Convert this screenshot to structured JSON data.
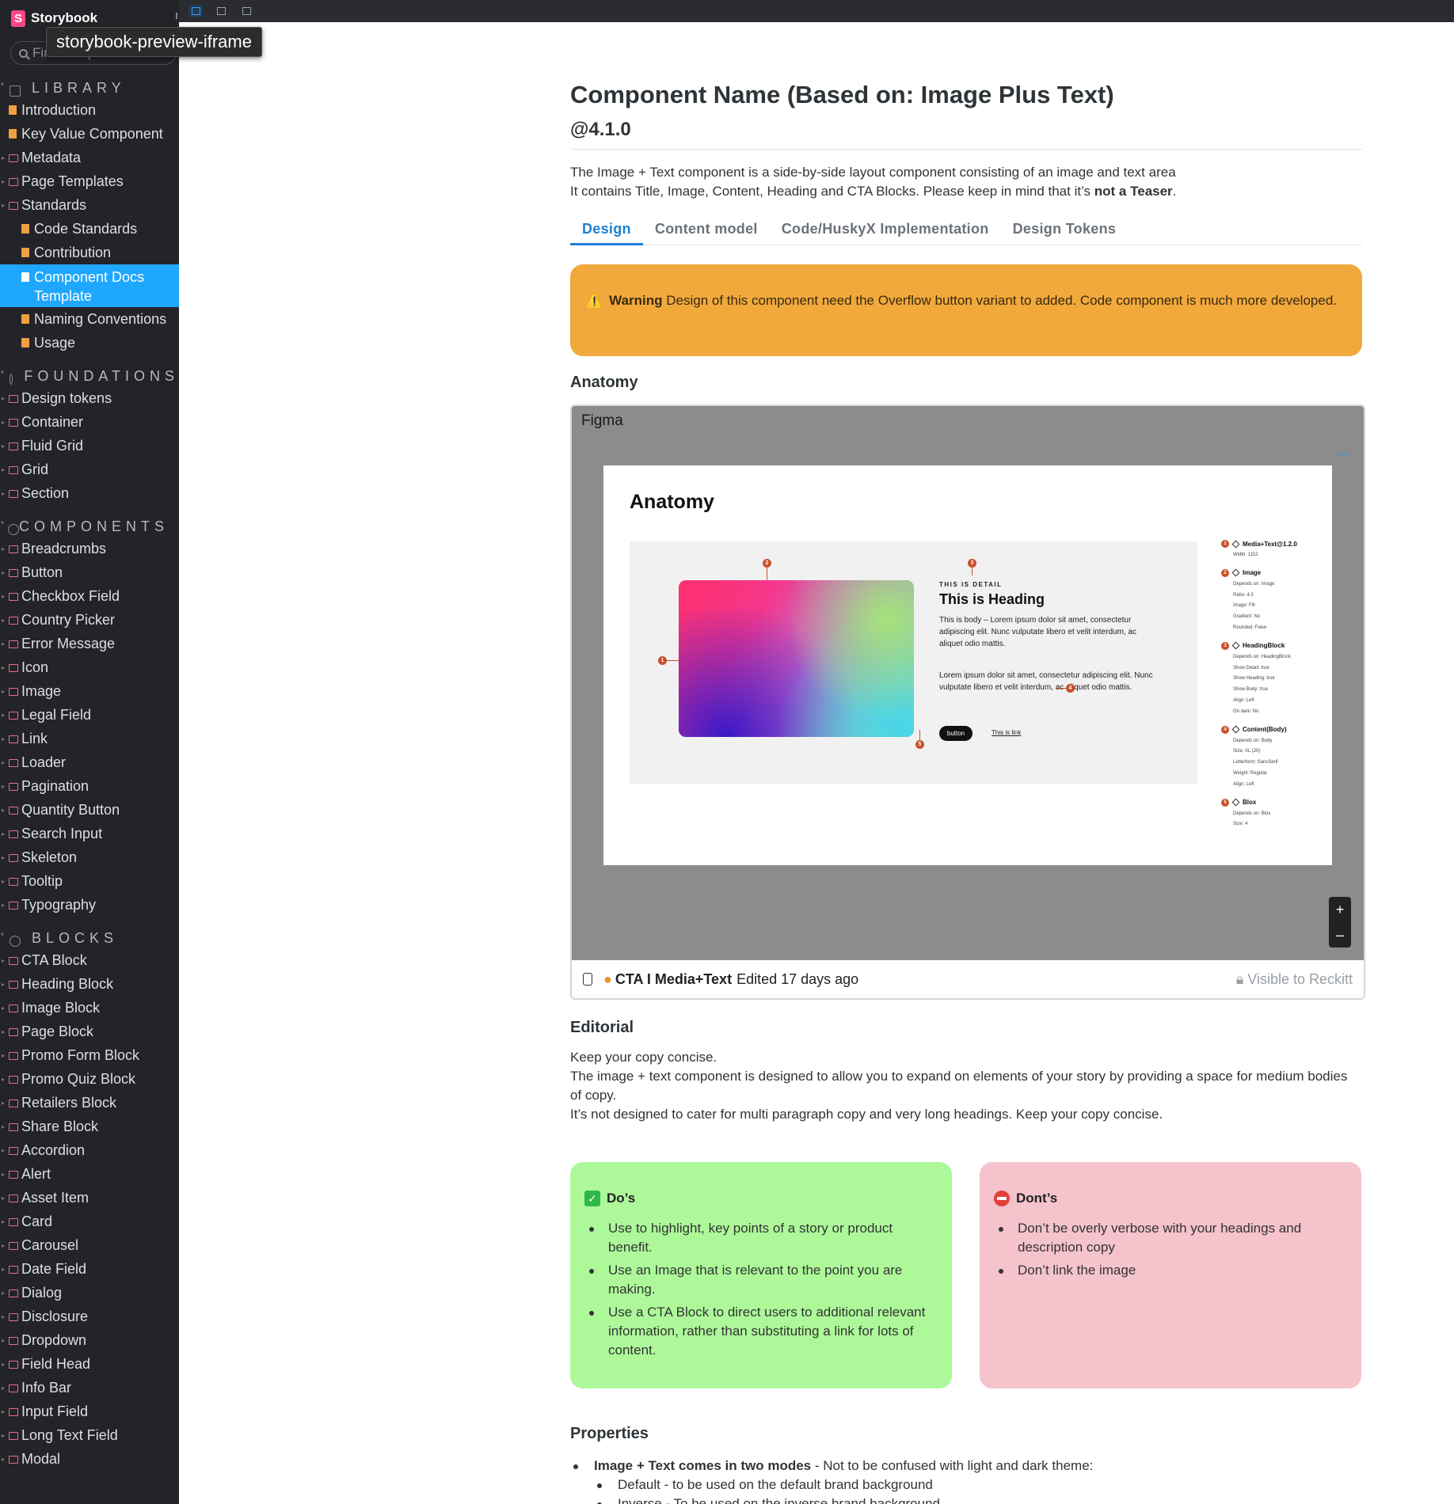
{
  "sidebar": {
    "brand": "Storybook",
    "search_placeholder": "Find components",
    "tooltip": "storybook-preview-iframe",
    "groups": [
      {
        "title": "LIBRARY",
        "items": [
          {
            "label": "Introduction",
            "type": "doc"
          },
          {
            "label": "Key Value Component",
            "type": "doc"
          },
          {
            "label": "Metadata",
            "type": "folder"
          },
          {
            "label": "Page Templates",
            "type": "folder"
          },
          {
            "label": "Standards",
            "type": "folder"
          },
          {
            "label": "Code Standards",
            "type": "doc",
            "sub": true
          },
          {
            "label": "Contribution",
            "type": "doc",
            "sub": true
          },
          {
            "label": "Component Docs Template",
            "type": "doc",
            "sub": true,
            "active": true
          },
          {
            "label": "Naming Conventions",
            "type": "doc",
            "sub": true
          },
          {
            "label": "Usage",
            "type": "doc",
            "sub": true
          }
        ]
      },
      {
        "title": "FOUNDATIONS",
        "items": [
          {
            "label": "Design tokens",
            "type": "folder"
          },
          {
            "label": "Container",
            "type": "folder"
          },
          {
            "label": "Fluid Grid",
            "type": "folder"
          },
          {
            "label": "Grid",
            "type": "folder"
          },
          {
            "label": "Section",
            "type": "folder"
          }
        ]
      },
      {
        "title": "COMPONENTS",
        "items": [
          {
            "label": "Breadcrumbs",
            "type": "folder"
          },
          {
            "label": "Button",
            "type": "folder"
          },
          {
            "label": "Checkbox Field",
            "type": "folder"
          },
          {
            "label": "Country Picker",
            "type": "folder"
          },
          {
            "label": "Error Message",
            "type": "folder"
          },
          {
            "label": "Icon",
            "type": "folder"
          },
          {
            "label": "Image",
            "type": "folder"
          },
          {
            "label": "Legal Field",
            "type": "folder"
          },
          {
            "label": "Link",
            "type": "folder"
          },
          {
            "label": "Loader",
            "type": "folder"
          },
          {
            "label": "Pagination",
            "type": "folder"
          },
          {
            "label": "Quantity Button",
            "type": "folder"
          },
          {
            "label": "Search Input",
            "type": "folder"
          },
          {
            "label": "Skeleton",
            "type": "folder"
          },
          {
            "label": "Tooltip",
            "type": "folder"
          },
          {
            "label": "Typography",
            "type": "folder"
          }
        ]
      },
      {
        "title": "BLOCKS",
        "items": [
          {
            "label": "CTA Block",
            "type": "folder"
          },
          {
            "label": "Heading Block",
            "type": "folder"
          },
          {
            "label": "Image Block",
            "type": "folder"
          },
          {
            "label": "Page Block",
            "type": "folder"
          },
          {
            "label": "Promo Form Block",
            "type": "folder"
          },
          {
            "label": "Promo Quiz Block",
            "type": "folder"
          },
          {
            "label": "Retailers Block",
            "type": "folder"
          },
          {
            "label": "Share Block",
            "type": "folder"
          },
          {
            "label": "Accordion",
            "type": "folder"
          },
          {
            "label": "Alert",
            "type": "folder"
          },
          {
            "label": "Asset Item",
            "type": "folder"
          },
          {
            "label": "Card",
            "type": "folder"
          },
          {
            "label": "Carousel",
            "type": "folder"
          },
          {
            "label": "Date Field",
            "type": "folder"
          },
          {
            "label": "Dialog",
            "type": "folder"
          },
          {
            "label": "Disclosure",
            "type": "folder"
          },
          {
            "label": "Dropdown",
            "type": "folder"
          },
          {
            "label": "Field Head",
            "type": "folder"
          },
          {
            "label": "Info Bar",
            "type": "folder"
          },
          {
            "label": "Input Field",
            "type": "folder"
          },
          {
            "label": "Long Text Field",
            "type": "folder"
          },
          {
            "label": "Modal",
            "type": "folder"
          }
        ]
      }
    ]
  },
  "doc": {
    "title": "Component Name (Based on: Image Plus Text)",
    "version": "@4.1.0",
    "intro_line1": "The Image + Text component is a side-by-side layout component consisting of an image and text area",
    "intro_line2_prefix": "It contains Title, Image, Content, Heading and CTA Blocks. Please keep in mind that it’s ",
    "intro_line2_bold": "not a Teaser",
    "intro_line2_suffix": ".",
    "tabs": [
      "Design",
      "Content model",
      "Code/HuskyX Implementation",
      "Design Tokens"
    ],
    "warning_icon": "⚠️",
    "warning_bold": "Warning",
    "warning_text": " Design of this component need the Overflow button variant to added. Code component is much more developed.",
    "anatomy_heading": "Anatomy",
    "figma": {
      "label": "Figma",
      "code_icon": "</>",
      "board_title": "Anatomy",
      "detail": "THIS IS  DETAIL",
      "heading": "This is Heading",
      "body1": "This is body – Lorem ipsum dolor sit amet, consectetur adipiscing elit. Nunc vulputate libero et velit interdum, ac aliquet odio mattis.",
      "body2": "Lorem ipsum dolor sit amet, consectetur adipiscing elit. Nunc vulputate libero et velit interdum, ac aliquet odio mattis.",
      "button": "button",
      "link": "This is link",
      "markers": [
        "1",
        "2",
        "3",
        "4",
        "5"
      ],
      "specs": [
        {
          "num": "1",
          "title": "Media+Text@1.2.0",
          "lines": [
            "Width: 1152"
          ]
        },
        {
          "num": "2",
          "title": "Image",
          "lines": [
            "Depends on: Image",
            "Ratio: 4:3",
            "Image: Fill",
            "Gradient: No",
            "Rounded: False"
          ]
        },
        {
          "num": "3",
          "title": "HeadingBlock",
          "lines": [
            "Depends on: HeadingBlock",
            "Show Detail: true",
            "Show Heading: true",
            "Show Body: true",
            "Align: Left",
            "On dark: No"
          ]
        },
        {
          "num": "4",
          "title": "Content(Body)",
          "lines": [
            "Depends on: Body",
            "Size: XL (20)",
            "Letterform: SansSerif",
            "Weight: Regular",
            "Align: Left"
          ]
        },
        {
          "num": "5",
          "title": "Blox",
          "lines": [
            "Depends on: Blox",
            "Size: 4"
          ]
        }
      ],
      "zoom_in": "+",
      "zoom_out": "–",
      "footer_file": "CTA I Media+Text",
      "footer_edited": "Edited 17 days ago",
      "footer_visibility": "Visible to Reckitt"
    },
    "editorial_heading": "Editorial",
    "editorial_lines": [
      "Keep your copy concise.",
      "The image + text component is designed to allow you to expand on elements of your story by providing a space for medium bodies of copy.",
      "It’s not designed to cater for multi paragraph copy and very long headings. Keep your copy concise."
    ],
    "dos_title": "Do’s",
    "dos": [
      "Use to highlight, key points of a story or product benefit.",
      "Use an Image that is relevant to the point you are making.",
      "Use a CTA Block to direct users to additional relevant information, rather than substituting a link for lots of content."
    ],
    "donts_title": "Dont’s",
    "donts": [
      "Don’t be overly verbose with your headings and description copy",
      "Don’t link the image"
    ],
    "properties_heading": "Properties",
    "prop_bold": "Image + Text comes in two modes",
    "prop_text": " - Not to be confused with light and dark theme:",
    "prop_sub": [
      "Default - to be used on the default brand background",
      "Inverse - To be used on the inverse brand background"
    ]
  },
  "colors": {
    "sidebar_bg": "#222428",
    "active_item": "#1ea7fd",
    "warning": "#f1a93c",
    "dos_bg": "#adf99a",
    "donts_bg": "#f4c3cb",
    "tab_active": "#1e7fd4"
  }
}
